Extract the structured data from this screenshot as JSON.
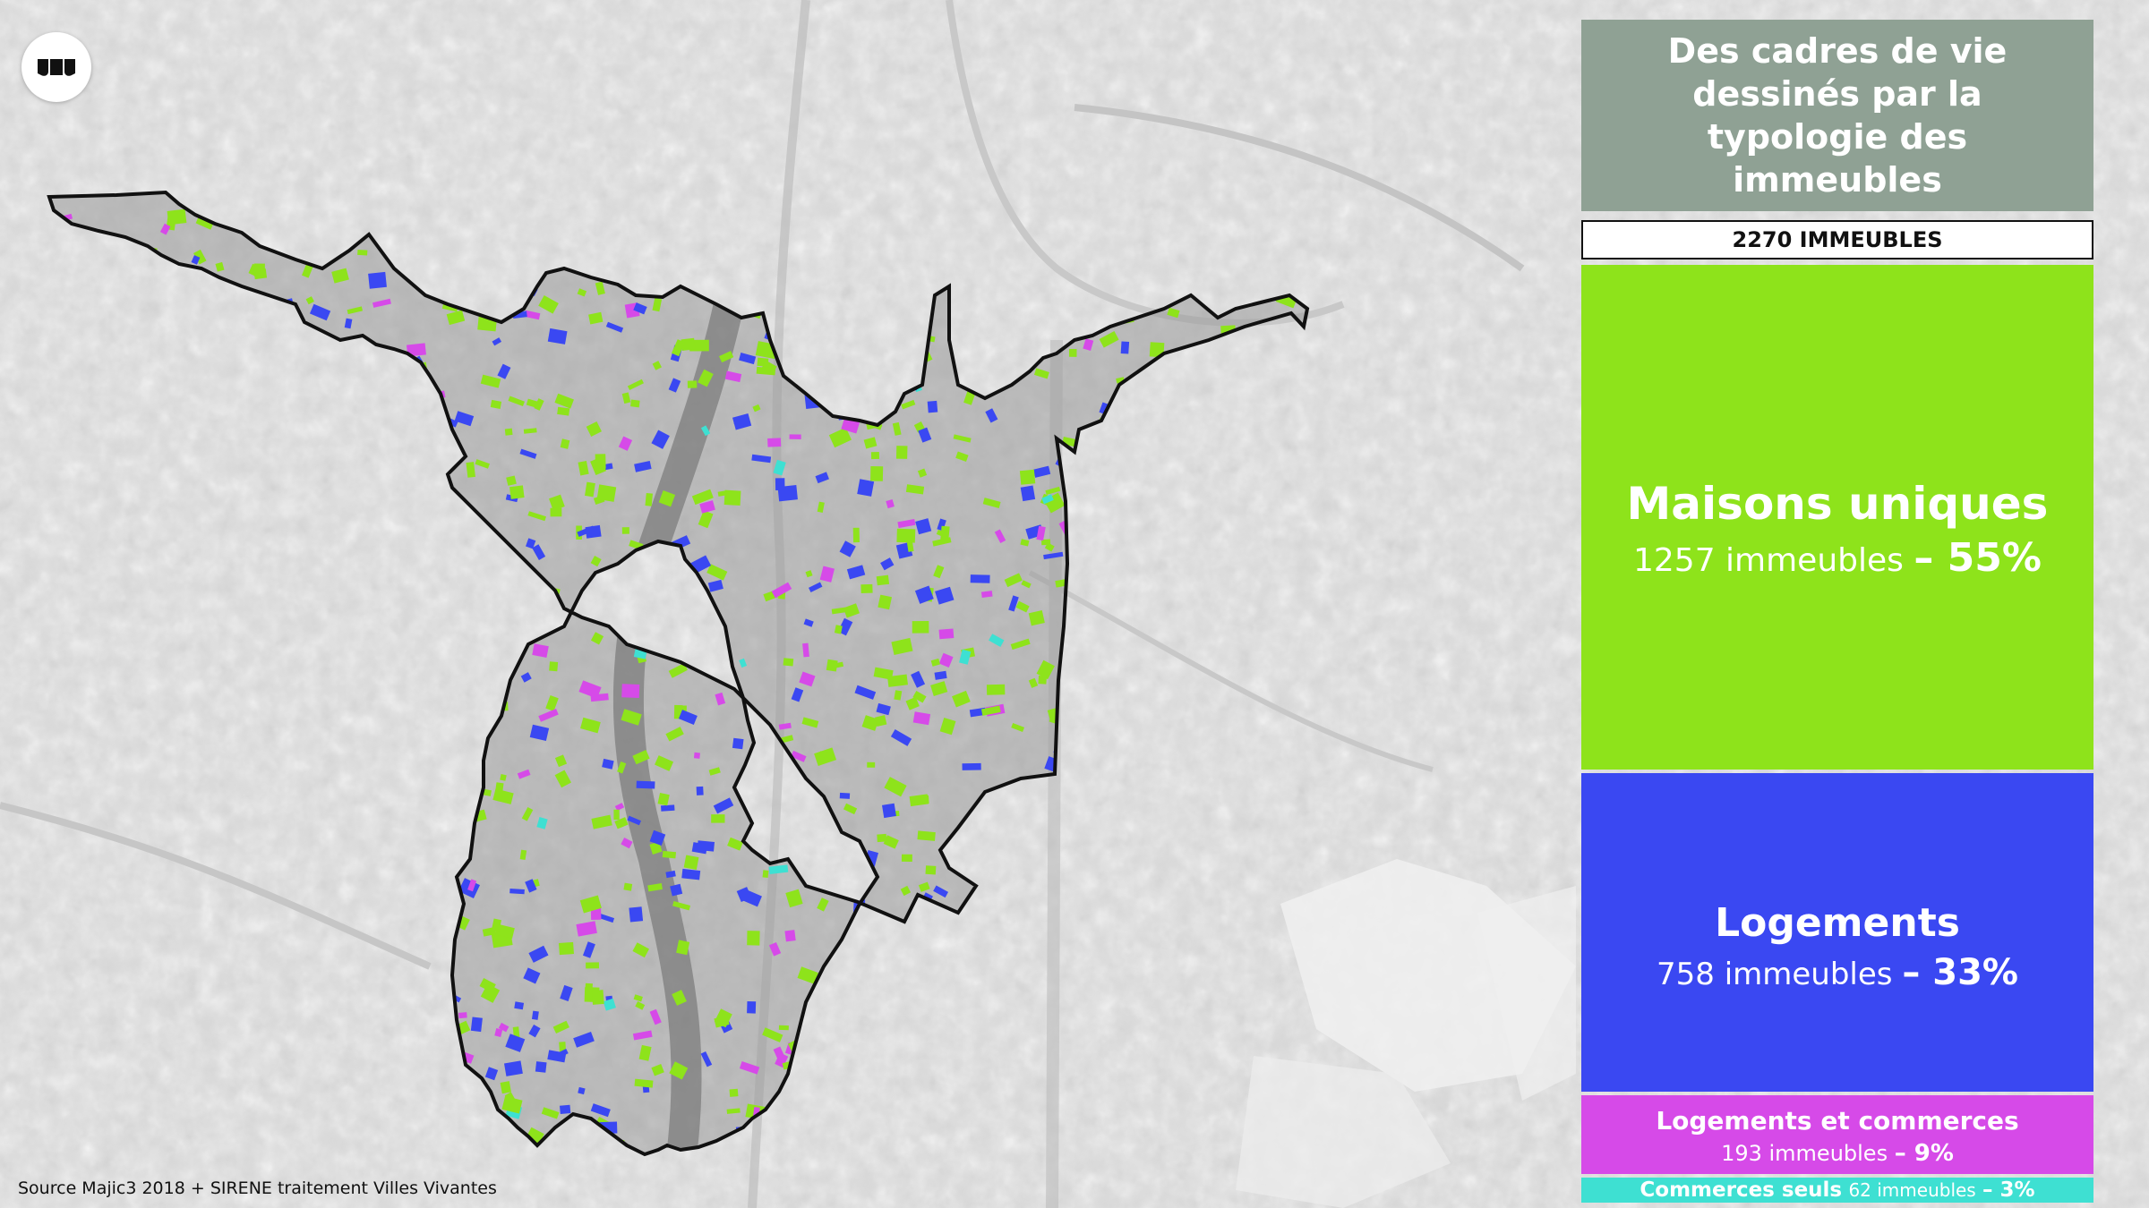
{
  "title": "Des cadres de vie dessinés par la typologie des immeubles",
  "total": "2270 IMMEUBLES",
  "categories": [
    {
      "name": "Maisons uniques",
      "count": "1257 immeubles",
      "pct": "– 55%",
      "color": "#8ee31b"
    },
    {
      "name": "Logements",
      "count": "758 immeubles",
      "pct": "– 33%",
      "color": "#3a48f2"
    },
    {
      "name": "Logements et commerces",
      "count": "193 immeubles",
      "pct": "– 9%",
      "color": "#d64ae8"
    },
    {
      "name": "Commerces seuls",
      "count": "62 immeubles",
      "pct": "– 3%",
      "color": "#3ee0d2"
    }
  ],
  "source": "Source Majic3 2018 + SIRENE traitement Villes Vivantes",
  "icons": {
    "logo": "brand-logo-icon"
  }
}
